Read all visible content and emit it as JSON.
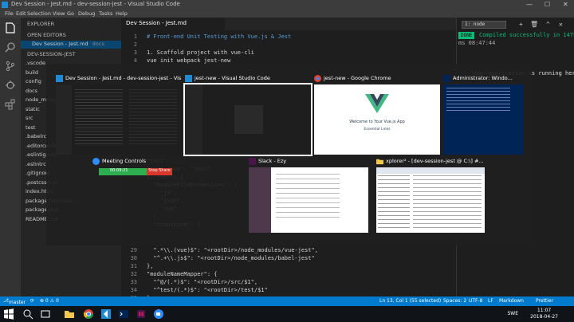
{
  "window": {
    "title": "Dev Session - Jest.md - dev-session-jest - Visual Studio Code",
    "controls": [
      "—",
      "☐",
      "✕"
    ]
  },
  "menu": [
    "File",
    "Edit",
    "Selection",
    "View",
    "Go",
    "Debug",
    "Tasks",
    "Help"
  ],
  "sidebar": {
    "header": "EXPLORER",
    "open_editors_label": "OPEN EDITORS",
    "open_file": "Dev Session - Jest.md",
    "open_file_dir": "docs",
    "project_label": "DEV-SESSION-JEST",
    "items": [
      ".vscode",
      "build",
      "config",
      "docs",
      "node_modules",
      "static",
      "src",
      "test",
      ".babelrc",
      ".editorconfig",
      ".eslintignore",
      ".eslintrc",
      ".gitignore",
      ".postcssrc.js",
      "index.html",
      "package-lock.json",
      "package.json",
      "README.md"
    ]
  },
  "editor": {
    "tab_label": "Dev Session - Jest.md",
    "lines_top": [
      {
        "n": "1",
        "text": "# Front-end Unit Testing with Vue.js & Jest"
      },
      {
        "n": "2",
        "text": ""
      },
      {
        "n": "3",
        "text": "1. Scaffold project with vue-cli"
      },
      {
        "n": "4",
        "text": "vue init webpack jest-new"
      }
    ],
    "lines_partial": [
      "\"jest\"",
      "\"test\": ...",
      "\"test-once\": \"jest\"",
      "},\"jest\": {",
      "  \"moduleFileExtensions\": [",
      "    \"js\",",
      "    \"json\",",
      "    \"vue\"",
      "  ],",
      "  \"transform\": {"
    ],
    "lines_bottom": [
      {
        "n": "29",
        "text": "  \".*\\\\.(vue)$\": \"<rootDir>/node_modules/vue-jest\","
      },
      {
        "n": "30",
        "text": "  \"^.+\\\\.js$\": \"<rootDir>/node_modules/babel-jest\""
      },
      {
        "n": "31",
        "text": "},"
      },
      {
        "n": "32",
        "text": "\"moduleNameMapper\": {"
      },
      {
        "n": "33",
        "text": "  \"^@/(.*)$\": \"<rootDir>/src/$1\","
      },
      {
        "n": "34",
        "text": "  \"^test/(.*)$\": \"<rootDir>/test/$1\""
      },
      {
        "n": "35",
        "text": "},"
      }
    ]
  },
  "terminal": {
    "selector": "1: node",
    "icons": [
      "+",
      "🗑",
      "^",
      "✕"
    ],
    "badge": "DONE",
    "lines": [
      "Compiled successfully in 1475",
      "ms          08:47:44",
      "",
      "Your application is running here"
    ]
  },
  "switcher": {
    "windows": [
      {
        "title": "Dev Session - Jest.md - dev-session-jest - Vis...",
        "app": "vscode"
      },
      {
        "title": "jest-new - Visual Studio Code",
        "app": "vscode"
      },
      {
        "title": "jest-new - Google Chrome",
        "app": "chrome"
      },
      {
        "title": "Administrator: Windo...",
        "app": "cmd"
      },
      {
        "title": "Meeting Controls",
        "app": "zoom"
      },
      {
        "title": "Slack - Ezy",
        "app": "slack"
      },
      {
        "title": "xplorer² - [dev-session-jest @ C:\\] #...",
        "app": "xplorer"
      }
    ],
    "chrome_thumb_text": [
      "Welcome to Your Vue.js App",
      "Essential Links"
    ],
    "meeting_bar_text": [
      "00:09:21",
      "Stop Share"
    ]
  },
  "statusbar": {
    "branch": "master",
    "sync": "⟳",
    "errors": "⊗ 0  ⚠ 0",
    "position": "Ln 13, Col 1 (55 selected)",
    "spaces": "Spaces: 2",
    "encoding": "UTF-8",
    "eol": "LF",
    "language": "Markdown",
    "formatter": "Prettier"
  },
  "taskbar": {
    "time": "11:07",
    "date": "2018-04-27",
    "lang": "SWE"
  },
  "colors": {
    "accent": "#007acc",
    "done": "#0dbc79",
    "vscode_blue": "#1e8ad6"
  }
}
